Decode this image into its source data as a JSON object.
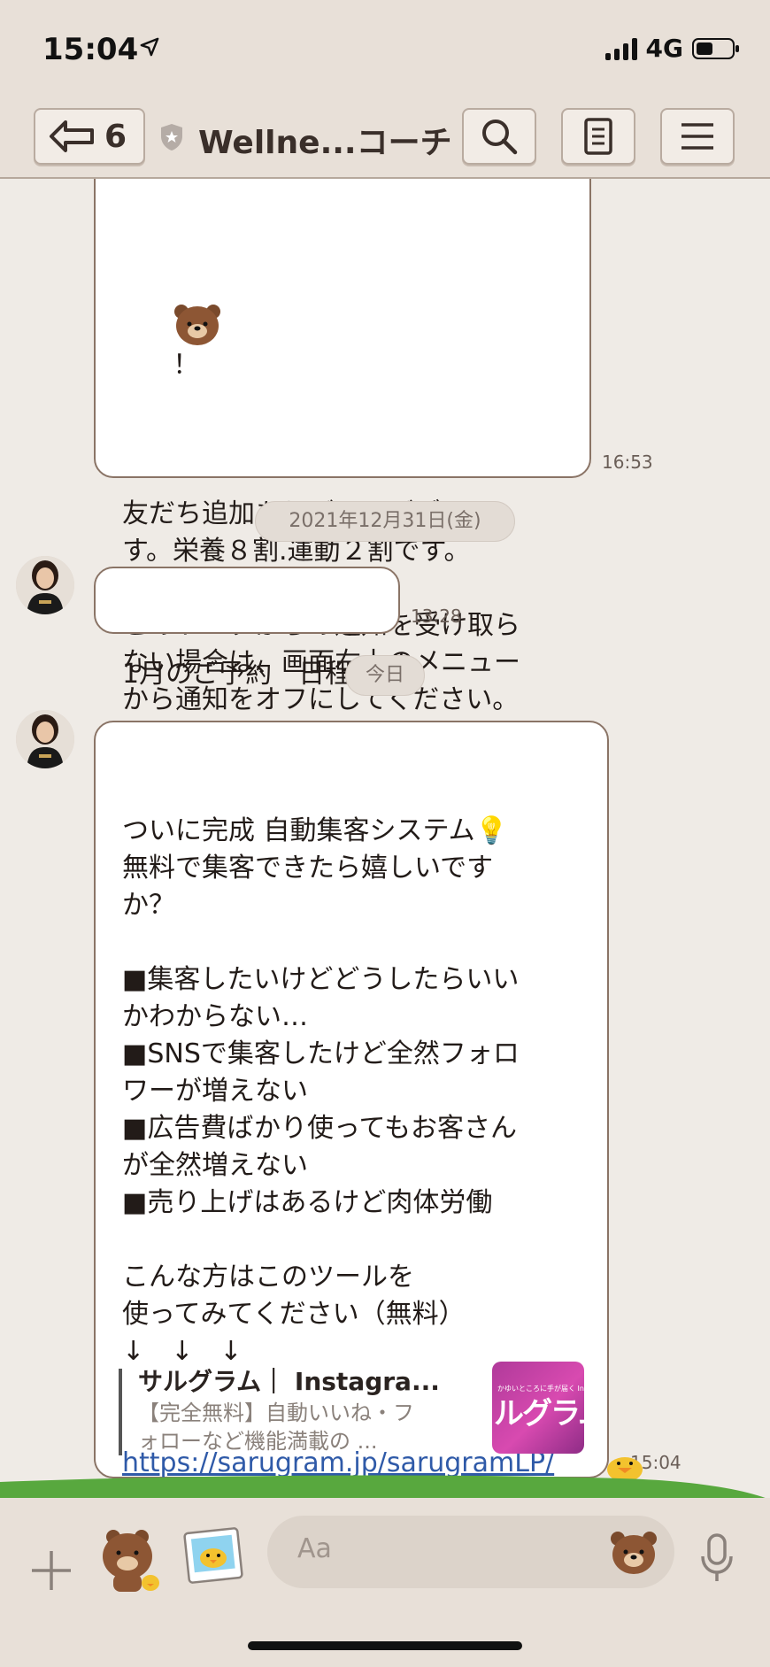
{
  "status_bar": {
    "time": "15:04",
    "network": "4G"
  },
  "nav": {
    "back_count": "6",
    "title": "Wellne...コーチ",
    "icons": [
      "back-arrow-icon",
      "shield-icon",
      "search-icon",
      "notes-icon",
      "menu-icon"
    ]
  },
  "messages": [
    {
      "id": "m1",
      "emoji_line": "！",
      "text": "友だち追加ありがとうございま\nす。栄養８割.運動２割です。\n\nこのトークからの通知を受け取ら\nない場合は、画面右上のメニュー\nから通知をオフにしてください。",
      "time": "16:53"
    },
    {
      "id": "m2",
      "date_separator": "2021年12月31日(金)",
      "text": "1月のご予約　日程",
      "time": "13:28"
    },
    {
      "id": "m3",
      "date_separator": "今日",
      "text": "ついに完成 自動集客システム💡\n無料で集客できたら嬉しいです\nか？\n\n■集客したいけどどうしたらいい\nかわからない…\n■SNSで集客したけど全然フォロ\nワーが増えない\n■広告費ばかり使ってもお客さん\nが全然増えない\n■売り上げはあるけど肉体労働\n\nこんな方はこのツールを\n使ってみてください（無料）\n↓　↓　↓",
      "link": "https://sarugram.jp/sarugramLP/",
      "preview": {
        "title": "サルグラム｜ Instagra...",
        "description": "【完全無料】自動いいね・フ\nォローなど機能満載の ...",
        "thumb_caption": "かゆいところに手が届く Instagram 自動集客ツールの",
        "thumb_text": "ルグラム"
      },
      "time": "15:04"
    }
  ],
  "input": {
    "placeholder": "Aa"
  }
}
